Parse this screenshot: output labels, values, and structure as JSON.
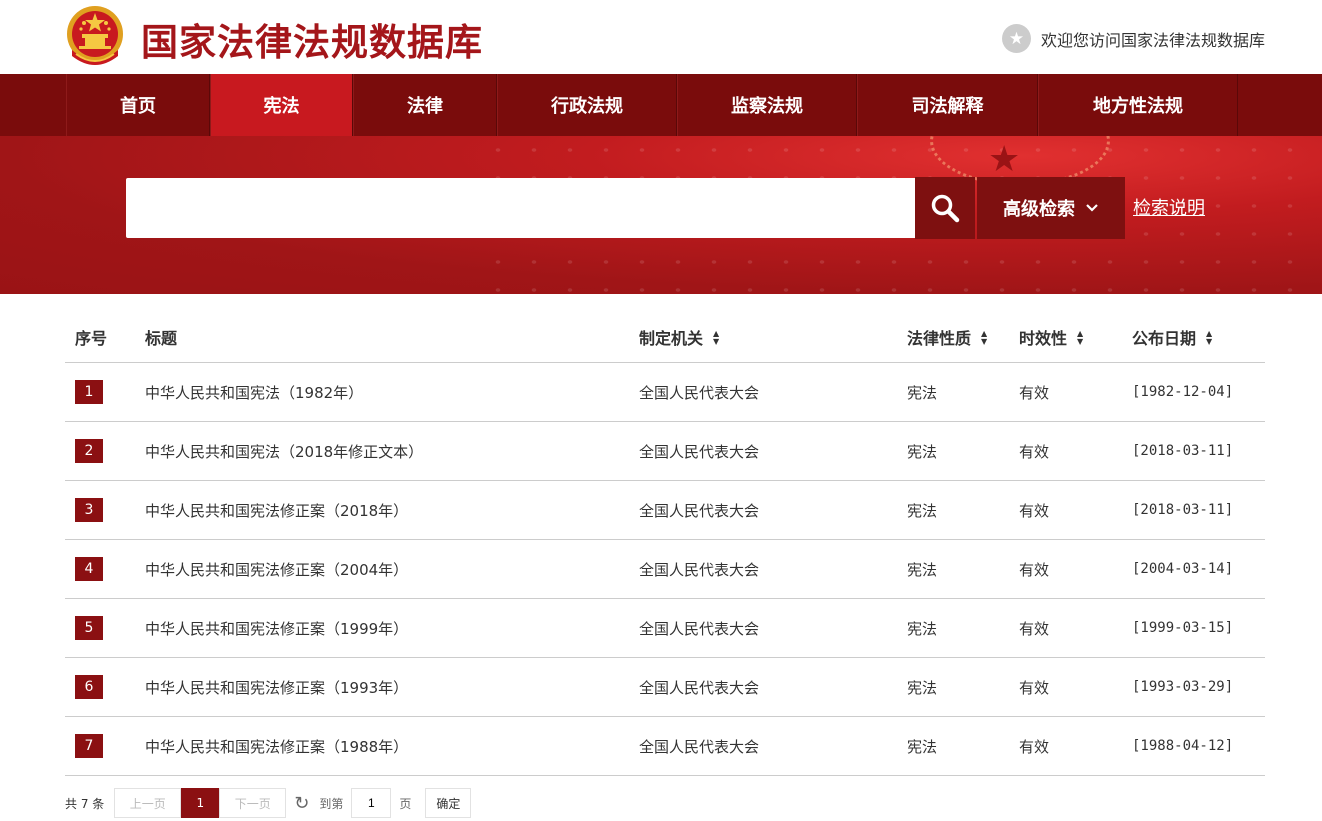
{
  "header": {
    "site_title": "国家法律法规数据库",
    "welcome": "欢迎您访问国家法律法规数据库"
  },
  "nav": {
    "items": [
      {
        "label": "首页",
        "active": false
      },
      {
        "label": "宪法",
        "active": true
      },
      {
        "label": "法律",
        "active": false
      },
      {
        "label": "行政法规",
        "active": false
      },
      {
        "label": "监察法规",
        "active": false
      },
      {
        "label": "司法解释",
        "active": false
      },
      {
        "label": "地方性法规",
        "active": false
      }
    ]
  },
  "search": {
    "value": "",
    "advanced_label": "高级检索",
    "help_label": "检索说明"
  },
  "table": {
    "headers": {
      "idx": "序号",
      "title": "标题",
      "org": "制定机关",
      "type": "法律性质",
      "validity": "时效性",
      "date": "公布日期"
    },
    "rows": [
      {
        "idx": "1",
        "title": "中华人民共和国宪法（1982年）",
        "org": "全国人民代表大会",
        "type": "宪法",
        "validity": "有效",
        "date": "[1982-12-04]"
      },
      {
        "idx": "2",
        "title": "中华人民共和国宪法（2018年修正文本）",
        "org": "全国人民代表大会",
        "type": "宪法",
        "validity": "有效",
        "date": "[2018-03-11]"
      },
      {
        "idx": "3",
        "title": "中华人民共和国宪法修正案（2018年）",
        "org": "全国人民代表大会",
        "type": "宪法",
        "validity": "有效",
        "date": "[2018-03-11]"
      },
      {
        "idx": "4",
        "title": "中华人民共和国宪法修正案（2004年）",
        "org": "全国人民代表大会",
        "type": "宪法",
        "validity": "有效",
        "date": "[2004-03-14]"
      },
      {
        "idx": "5",
        "title": "中华人民共和国宪法修正案（1999年）",
        "org": "全国人民代表大会",
        "type": "宪法",
        "validity": "有效",
        "date": "[1999-03-15]"
      },
      {
        "idx": "6",
        "title": "中华人民共和国宪法修正案（1993年）",
        "org": "全国人民代表大会",
        "type": "宪法",
        "validity": "有效",
        "date": "[1993-03-29]"
      },
      {
        "idx": "7",
        "title": "中华人民共和国宪法修正案（1988年）",
        "org": "全国人民代表大会",
        "type": "宪法",
        "validity": "有效",
        "date": "[1988-04-12]"
      }
    ]
  },
  "pager": {
    "total": "共 7 条",
    "prev": "上一页",
    "current": "1",
    "next": "下一页",
    "goto_prefix": "到第",
    "goto_value": "1",
    "goto_suffix": "页",
    "confirm": "确定"
  },
  "colors": {
    "brand_red": "#a4161a",
    "nav_dark": "#7a0c0c",
    "nav_active": "#c8191f",
    "badge": "#8b1012"
  }
}
